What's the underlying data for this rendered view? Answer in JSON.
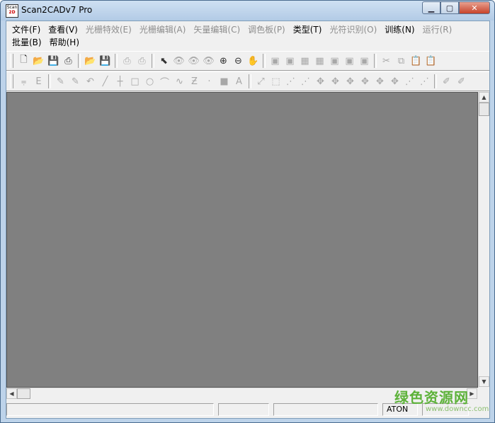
{
  "window": {
    "title": "Scan2CADv7 Pro",
    "app_icon_text_top": "Scan",
    "app_icon_text_bottom": "2D"
  },
  "menus": {
    "row1": [
      {
        "label": "文件(F)",
        "enabled": true
      },
      {
        "label": "查看(V)",
        "enabled": true
      },
      {
        "label": "光栅特效(E)",
        "enabled": false
      },
      {
        "label": "光栅编辑(A)",
        "enabled": false
      },
      {
        "label": "矢量编辑(C)",
        "enabled": false
      },
      {
        "label": "调色板(P)",
        "enabled": false
      },
      {
        "label": "类型(T)",
        "enabled": true
      },
      {
        "label": "光符识别(O)",
        "enabled": false
      },
      {
        "label": "训练(N)",
        "enabled": true
      },
      {
        "label": "运行(R)",
        "enabled": false
      }
    ],
    "row2": [
      {
        "label": "批量(B)",
        "enabled": true
      },
      {
        "label": "帮助(H)",
        "enabled": true
      }
    ]
  },
  "toolbar1": [
    {
      "icon": "new-document-icon",
      "glyph": "🗋",
      "enabled": true
    },
    {
      "icon": "open-folder-icon",
      "glyph": "📂",
      "enabled": true
    },
    {
      "icon": "save-icon",
      "glyph": "💾",
      "enabled": false
    },
    {
      "icon": "scan-icon",
      "glyph": "⎙",
      "enabled": true
    },
    {
      "sep": true
    },
    {
      "icon": "open-vector-icon",
      "glyph": "📂",
      "enabled": true
    },
    {
      "icon": "save-vector-icon",
      "glyph": "💾",
      "enabled": false
    },
    {
      "sep": true
    },
    {
      "icon": "print-icon",
      "glyph": "⎙",
      "enabled": false
    },
    {
      "icon": "print-preview-icon",
      "glyph": "⎙",
      "enabled": false
    },
    {
      "sep": true
    },
    {
      "icon": "pointer-icon",
      "glyph": "⬉",
      "enabled": true
    },
    {
      "icon": "view-raster-icon",
      "glyph": "👁",
      "enabled": false
    },
    {
      "icon": "view-vector-icon",
      "glyph": "👁",
      "enabled": false
    },
    {
      "icon": "view-both-icon",
      "glyph": "👁",
      "enabled": false
    },
    {
      "icon": "zoom-in-icon",
      "glyph": "⊕",
      "enabled": true
    },
    {
      "icon": "zoom-out-icon",
      "glyph": "⊖",
      "enabled": true
    },
    {
      "icon": "pan-hand-icon",
      "glyph": "✋",
      "enabled": false
    },
    {
      "sep": true
    },
    {
      "icon": "frame-1-icon",
      "glyph": "▣",
      "enabled": false
    },
    {
      "icon": "frame-2-icon",
      "glyph": "▣",
      "enabled": false
    },
    {
      "icon": "frame-3-icon",
      "glyph": "▦",
      "enabled": false
    },
    {
      "icon": "frame-4-icon",
      "glyph": "▦",
      "enabled": false
    },
    {
      "icon": "frame-5-icon",
      "glyph": "▣",
      "enabled": false
    },
    {
      "icon": "frame-6-icon",
      "glyph": "▣",
      "enabled": false
    },
    {
      "icon": "frame-7-icon",
      "glyph": "▣",
      "enabled": false
    },
    {
      "sep": true
    },
    {
      "icon": "cut-icon",
      "glyph": "✂",
      "enabled": false
    },
    {
      "icon": "copy-icon",
      "glyph": "⧉",
      "enabled": false
    },
    {
      "icon": "paste-icon",
      "glyph": "📋",
      "enabled": false
    },
    {
      "icon": "paste-special-icon",
      "glyph": "📋",
      "enabled": false
    }
  ],
  "toolbar2": [
    {
      "icon": "align-left-icon",
      "glyph": "⩦",
      "enabled": false
    },
    {
      "icon": "align-right-icon",
      "glyph": "Ε",
      "enabled": false
    },
    {
      "sep": true
    },
    {
      "icon": "pen-icon",
      "glyph": "✎",
      "enabled": false
    },
    {
      "icon": "pen-double-icon",
      "glyph": "✎",
      "enabled": false
    },
    {
      "icon": "undo-curve-icon",
      "glyph": "↶",
      "enabled": false
    },
    {
      "icon": "line-icon",
      "glyph": "╱",
      "enabled": false
    },
    {
      "icon": "cross-line-icon",
      "glyph": "┼",
      "enabled": false
    },
    {
      "icon": "rectangle-icon",
      "glyph": "□",
      "enabled": false
    },
    {
      "icon": "circle-icon",
      "glyph": "○",
      "enabled": false
    },
    {
      "icon": "arc-icon",
      "glyph": "⌒",
      "enabled": false
    },
    {
      "icon": "wave-icon",
      "glyph": "∿",
      "enabled": false
    },
    {
      "icon": "z-icon",
      "glyph": "Ƶ",
      "enabled": false
    },
    {
      "icon": "point-icon",
      "glyph": "·",
      "enabled": false
    },
    {
      "icon": "fill-icon",
      "glyph": "■",
      "enabled": false
    },
    {
      "icon": "text-icon",
      "glyph": "A",
      "enabled": false
    },
    {
      "sep": true
    },
    {
      "icon": "vector-diag-icon",
      "glyph": "⤢",
      "enabled": false
    },
    {
      "icon": "vector-axes-icon",
      "glyph": "⬚",
      "enabled": false
    },
    {
      "icon": "vector-node-1-icon",
      "glyph": "⋰",
      "enabled": false
    },
    {
      "icon": "vector-node-2-icon",
      "glyph": "⋰",
      "enabled": false
    },
    {
      "icon": "vector-node-3-icon",
      "glyph": "✥",
      "enabled": false
    },
    {
      "icon": "vector-node-4-icon",
      "glyph": "✥",
      "enabled": false
    },
    {
      "icon": "vector-node-5-icon",
      "glyph": "✥",
      "enabled": false
    },
    {
      "icon": "vector-node-6-icon",
      "glyph": "✥",
      "enabled": false
    },
    {
      "icon": "vector-node-7-icon",
      "glyph": "✥",
      "enabled": false
    },
    {
      "icon": "vector-node-8-icon",
      "glyph": "✥",
      "enabled": false
    },
    {
      "icon": "vector-node-9-icon",
      "glyph": "⋰",
      "enabled": false
    },
    {
      "icon": "vector-node-10-icon",
      "glyph": "⋰",
      "enabled": false
    },
    {
      "sep": true
    },
    {
      "icon": "eyedropper-icon",
      "glyph": "✐",
      "enabled": false
    },
    {
      "icon": "eyedropper-plus-icon",
      "glyph": "✐",
      "enabled": false
    }
  ],
  "status": {
    "pane1": "",
    "pane2": "",
    "pane3": "",
    "mode": "ATON",
    "pane5": ""
  },
  "watermark": {
    "text": "绿色资源网",
    "url": "www.downcc.com"
  },
  "colors": {
    "canvas": "#808080",
    "chrome": "#f0f0f0",
    "title_gradient_top": "#cfe0f2",
    "close_button": "#c7432b"
  }
}
